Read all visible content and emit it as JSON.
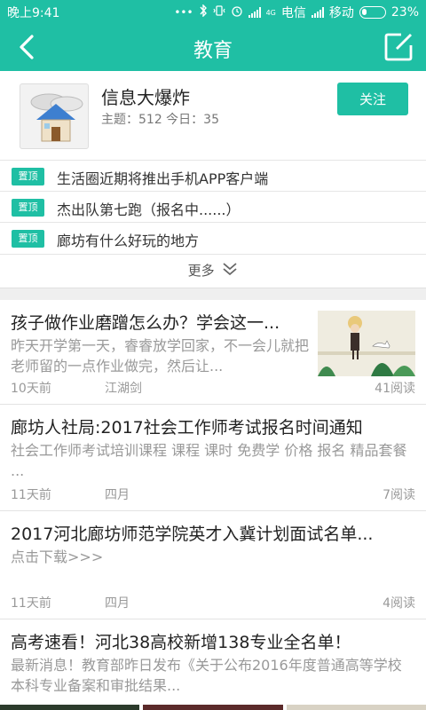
{
  "status": {
    "time": "晚上9:41",
    "dots": "•••",
    "net_speed": "4G",
    "carrier1": "电信",
    "carrier2": "移动",
    "battery": "23%",
    "battery_level": 0.23
  },
  "nav": {
    "title": "教育"
  },
  "forum": {
    "name": "信息大爆炸",
    "stats": "主题：512  今日：35",
    "follow_label": "关注"
  },
  "pinned": {
    "tag": "置顶",
    "items": [
      "生活圈近期将推出手机APP客户端",
      "杰出队第七跑（报名中......）",
      "廊坊有什么好玩的地方"
    ],
    "more_label": "更多"
  },
  "posts": [
    {
      "title": "孩子做作业磨蹭怎么办？学会这一...",
      "summary": "昨天开学第一天，睿睿放学回家，不一会儿就把老师留的一点作业做完，然后让...",
      "date": "10天前",
      "author": "江湖剑",
      "reads": "41阅读"
    },
    {
      "title": "廊坊人社局:2017社会工作师考试报名时间通知",
      "summary": "社会工作师考试培训课程  课程  课时  免费学  价格  报名  精品套餐  ...",
      "date": "11天前",
      "author": "四月",
      "reads": "7阅读"
    },
    {
      "title": "2017河北廊坊师范学院英才入冀计划面试名单...",
      "summary": "点击下载>>>",
      "date": "11天前",
      "author": "四月",
      "reads": "4阅读"
    },
    {
      "title": "高考速看！河北38高校新增138专业全名单！",
      "summary": "最新消息！教育部昨日发布《关于公布2016年度普通高等学校本科专业备案和审批结果...",
      "date": "",
      "author": "",
      "reads": ""
    }
  ],
  "colors": {
    "accent": "#1fbfa4",
    "divider": "#e6e6e6"
  }
}
